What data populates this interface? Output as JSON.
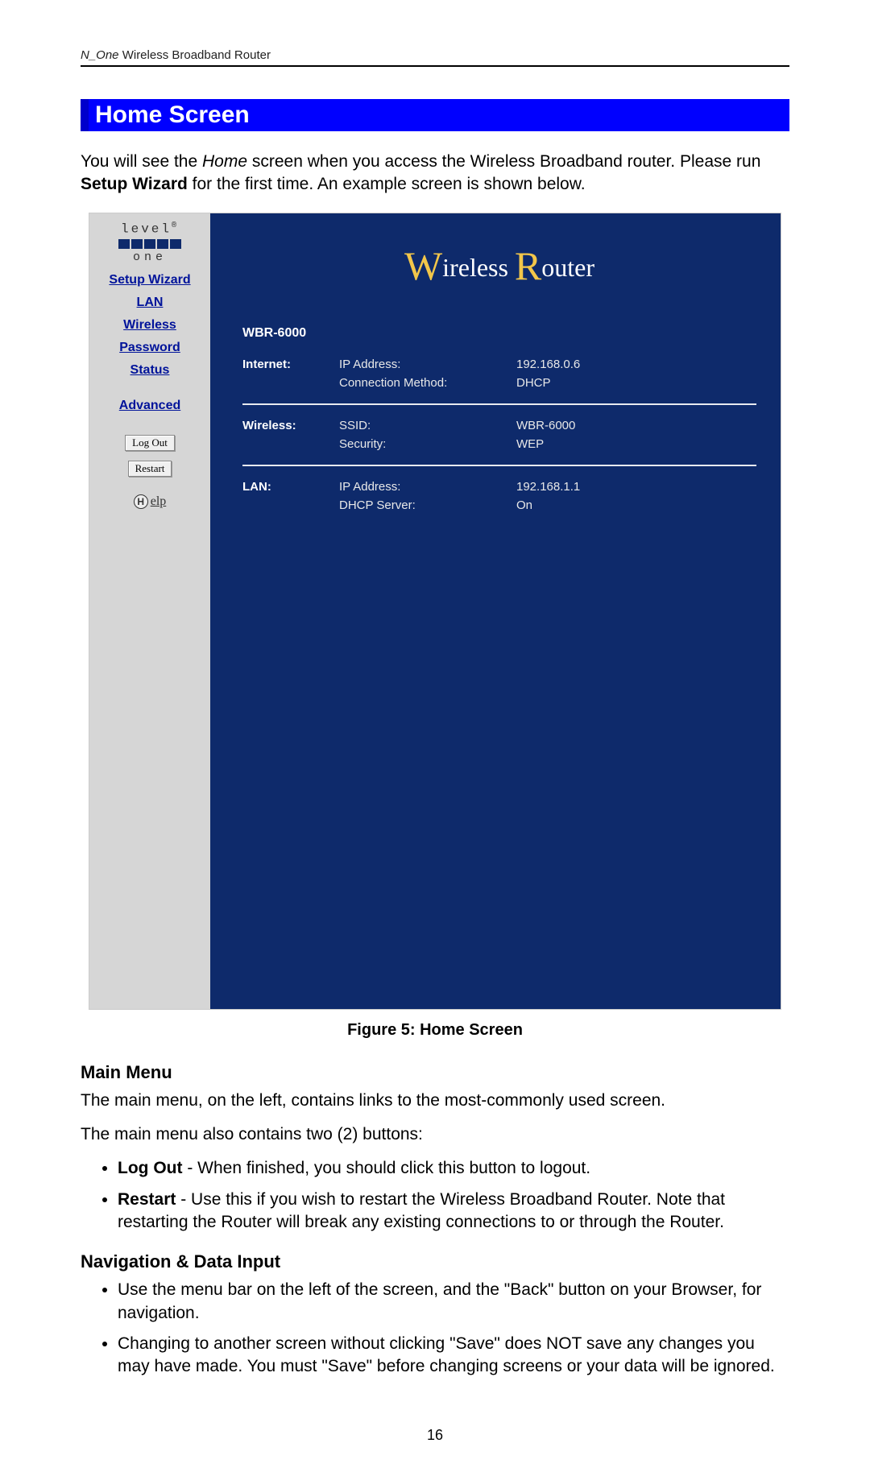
{
  "header": {
    "product_italic": "N_One",
    "product_rest": " Wireless Broadband Router"
  },
  "section_title": "Home Screen",
  "intro": {
    "line1_a": "You will see the ",
    "line1_home": "Home",
    "line1_b": " screen when you access the Wireless Broadband router. Please run ",
    "line1_bold": "Setup Wizard",
    "line1_c": " for the first time. An example screen is shown below."
  },
  "screenshot": {
    "logo_top": "level",
    "logo_reg": "®",
    "logo_sub": "one",
    "nav": {
      "setup_wizard": "Setup Wizard",
      "lan": "LAN",
      "wireless": "Wireless",
      "password": "Password",
      "status": "Status",
      "advanced": "Advanced"
    },
    "buttons": {
      "logout": "Log Out",
      "restart": "Restart"
    },
    "help_label": "elp",
    "title_w": "W",
    "title_ireless": "ireless",
    "title_r": "R",
    "title_outer": "outer",
    "model": "WBR-6000",
    "sections": {
      "internet": {
        "label": "Internet:",
        "rows": [
          {
            "k": "IP Address:",
            "v": "192.168.0.6"
          },
          {
            "k": "Connection Method:",
            "v": "DHCP"
          }
        ]
      },
      "wireless": {
        "label": "Wireless:",
        "rows": [
          {
            "k": "SSID:",
            "v": "WBR-6000"
          },
          {
            "k": "Security:",
            "v": "WEP"
          }
        ]
      },
      "lan": {
        "label": "LAN:",
        "rows": [
          {
            "k": "IP Address:",
            "v": "192.168.1.1"
          },
          {
            "k": "DHCP Server:",
            "v": "On"
          }
        ]
      }
    }
  },
  "figure_caption": "Figure 5: Home Screen",
  "main_menu": {
    "heading": "Main Menu",
    "p1": "The main menu, on the left, contains links to the most-commonly used screen.",
    "p2": "The main menu also contains two (2) buttons:",
    "b1_bold": "Log Out",
    "b1_rest": " - When finished, you should click this button to logout.",
    "b2_bold": "Restart",
    "b2_rest": " - Use this if you wish to restart the Wireless Broadband Router. Note that restarting the Router will break any existing connections to or through the Router."
  },
  "nav_input": {
    "heading": "Navigation & Data Input",
    "b1": "Use the menu bar on the left of the screen, and the \"Back\" button on your Browser, for navigation.",
    "b2": "Changing to another screen without clicking \"Save\" does NOT save any changes you may have made. You must \"Save\" before changing screens or your data will be ignored."
  },
  "page_number": "16"
}
